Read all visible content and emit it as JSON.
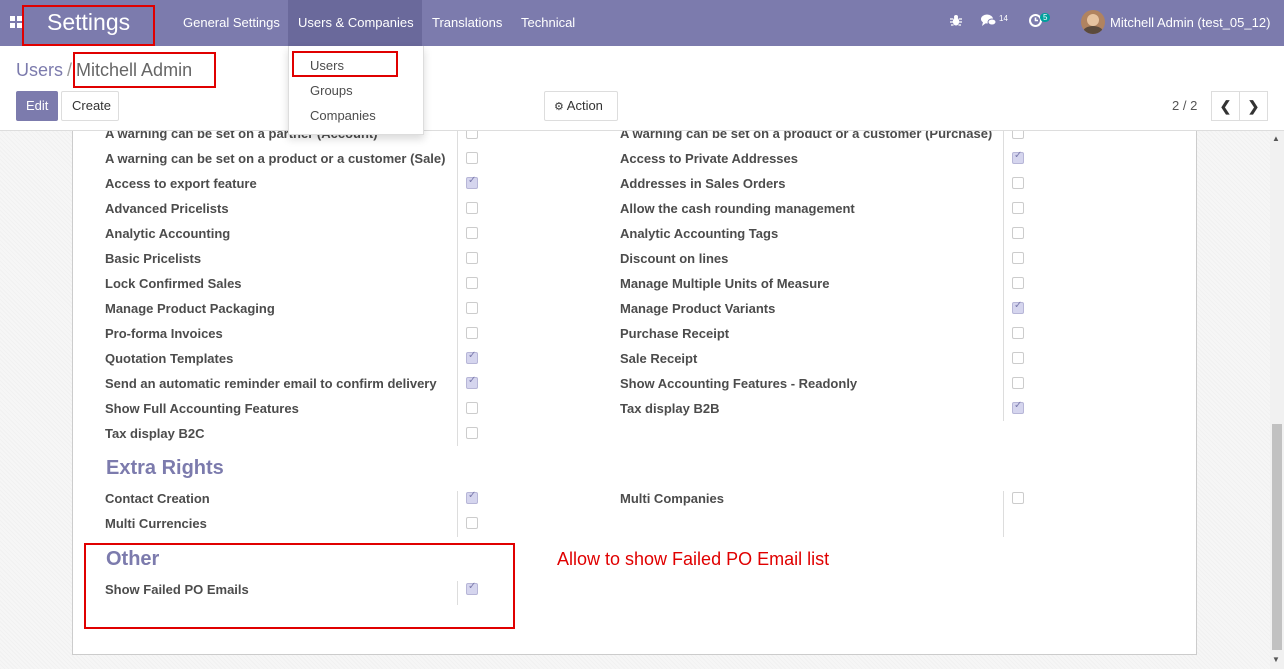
{
  "nav": {
    "app_title": "Settings",
    "menus": [
      "General Settings",
      "Users & Companies",
      "Translations",
      "Technical"
    ],
    "chat_count": "14",
    "activity_count": "5",
    "user": "Mitchell Admin (test_05_12)"
  },
  "dropdown": {
    "items": [
      "Users",
      "Groups",
      "Companies"
    ]
  },
  "breadcrumb": {
    "parent": "Users",
    "separator": "/",
    "current": "Mitchell Admin"
  },
  "buttons": {
    "edit": "Edit",
    "create": "Create",
    "action": "Action"
  },
  "pager": {
    "value": "2 / 2"
  },
  "rights_left": [
    {
      "label": "A warning can be set on a partner (Account)",
      "checked": false
    },
    {
      "label": "A warning can be set on a product or a customer (Sale)",
      "checked": false
    },
    {
      "label": "Access to export feature",
      "checked": true
    },
    {
      "label": "Advanced Pricelists",
      "checked": false
    },
    {
      "label": "Analytic Accounting",
      "checked": false
    },
    {
      "label": "Basic Pricelists",
      "checked": false
    },
    {
      "label": "Lock Confirmed Sales",
      "checked": false
    },
    {
      "label": "Manage Product Packaging",
      "checked": false
    },
    {
      "label": "Pro-forma Invoices",
      "checked": false
    },
    {
      "label": "Quotation Templates",
      "checked": true
    },
    {
      "label": "Send an automatic reminder email to confirm delivery",
      "checked": true
    },
    {
      "label": "Show Full Accounting Features",
      "checked": false
    },
    {
      "label": "Tax display B2C",
      "checked": false
    }
  ],
  "rights_right": [
    {
      "label": "A warning can be set on a product or a customer (Purchase)",
      "checked": false
    },
    {
      "label": "Access to Private Addresses",
      "checked": true
    },
    {
      "label": "Addresses in Sales Orders",
      "checked": false
    },
    {
      "label": "Allow the cash rounding management",
      "checked": false
    },
    {
      "label": "Analytic Accounting Tags",
      "checked": false
    },
    {
      "label": "Discount on lines",
      "checked": false
    },
    {
      "label": "Manage Multiple Units of Measure",
      "checked": false
    },
    {
      "label": "Manage Product Variants",
      "checked": true
    },
    {
      "label": "Purchase Receipt",
      "checked": false
    },
    {
      "label": "Sale Receipt",
      "checked": false
    },
    {
      "label": "Show Accounting Features - Readonly",
      "checked": false
    },
    {
      "label": "Tax display B2B",
      "checked": true
    }
  ],
  "extra_rights": {
    "title": "Extra Rights",
    "left": [
      {
        "label": "Contact Creation",
        "checked": true
      },
      {
        "label": "Multi Currencies",
        "checked": false
      }
    ],
    "right": [
      {
        "label": "Multi Companies",
        "checked": false
      }
    ]
  },
  "other": {
    "title": "Other",
    "items": [
      {
        "label": "Show Failed PO Emails",
        "checked": true
      }
    ]
  },
  "annotation": "Allow to show Failed PO Email list",
  "colors": {
    "brand": "#7c7bad",
    "annotation": "#e00000"
  }
}
